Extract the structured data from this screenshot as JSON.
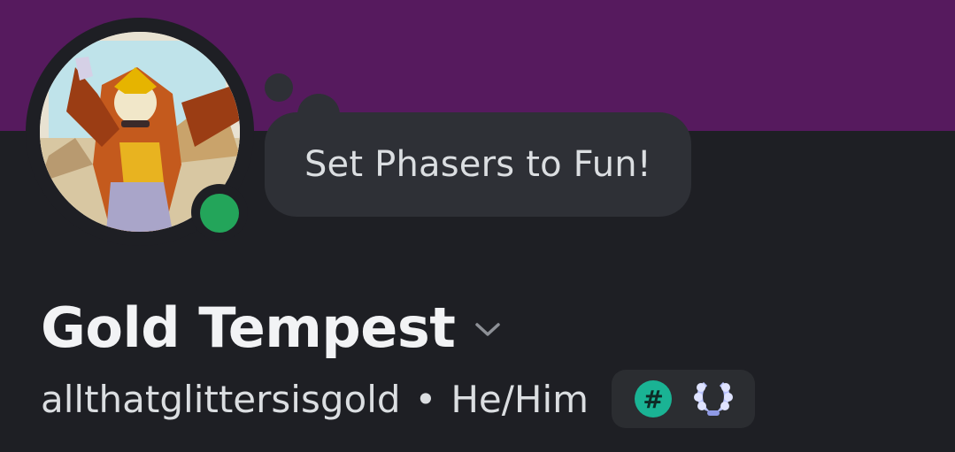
{
  "profile": {
    "status_message": "Set Phasers to Fun!",
    "display_name": "Gold Tempest",
    "username": "allthatglittersisgold",
    "separator": "•",
    "pronouns": "He/Him",
    "online_status": "online"
  },
  "badges": [
    {
      "icon": "hash-badge-icon",
      "glyph": "#"
    },
    {
      "icon": "laurel-badge-icon"
    }
  ],
  "colors": {
    "banner": "#561a5e",
    "background": "#1e1f24",
    "status_online": "#23a55a",
    "bubble": "#2e3036",
    "hash_badge": "#1ab394",
    "laurel_badge": "#b9c3ff"
  }
}
